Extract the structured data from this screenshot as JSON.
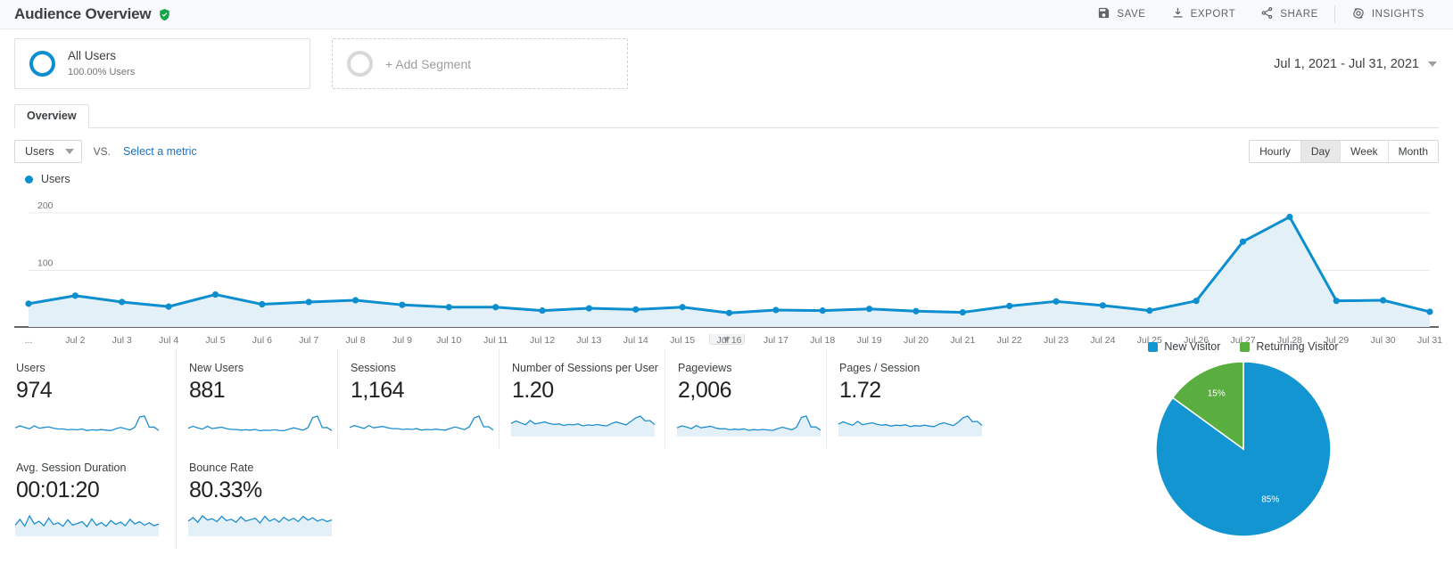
{
  "header": {
    "title": "Audience Overview",
    "verified_icon": "verified-shield-icon",
    "toolbar": [
      {
        "label": "SAVE",
        "icon": "save-floppy-icon"
      },
      {
        "label": "EXPORT",
        "icon": "export-download-icon"
      },
      {
        "label": "SHARE",
        "icon": "share-nodes-icon"
      },
      {
        "label": "INSIGHTS",
        "icon": "insights-icon"
      }
    ]
  },
  "segments": {
    "all_users": {
      "name": "All Users",
      "sub": "100.00% Users"
    },
    "add_segment": {
      "label": "+ Add Segment"
    }
  },
  "date_range": {
    "value": "Jul 1, 2021 - Jul 31, 2021"
  },
  "tabs": [
    {
      "label": "Overview",
      "active": true
    }
  ],
  "metric_selector": {
    "selected": "Users",
    "vs_label": "VS.",
    "compare_link": "Select a metric"
  },
  "granularity": {
    "options": [
      "Hourly",
      "Day",
      "Week",
      "Month"
    ],
    "selected": "Day"
  },
  "chart_data": {
    "type": "line",
    "title": "Users",
    "legend": [
      "Users"
    ],
    "legend_position": "top-left",
    "grid": true,
    "xlabel": "",
    "ylabel": "",
    "ylim": [
      0,
      220
    ],
    "yticks": [
      100,
      200
    ],
    "categories": [
      "...",
      "Jul 2",
      "Jul 3",
      "Jul 4",
      "Jul 5",
      "Jul 6",
      "Jul 7",
      "Jul 8",
      "Jul 9",
      "Jul 10",
      "Jul 11",
      "Jul 12",
      "Jul 13",
      "Jul 14",
      "Jul 15",
      "Jul 16",
      "Jul 17",
      "Jul 18",
      "Jul 19",
      "Jul 20",
      "Jul 21",
      "Jul 22",
      "Jul 23",
      "Jul 24",
      "Jul 25",
      "Jul 26",
      "Jul 27",
      "Jul 28",
      "Jul 29",
      "Jul 30",
      "Jul 31"
    ],
    "series": [
      {
        "name": "Users",
        "values": [
          42,
          56,
          45,
          37,
          58,
          41,
          45,
          48,
          40,
          36,
          36,
          30,
          34,
          32,
          36,
          26,
          31,
          30,
          33,
          29,
          27,
          38,
          46,
          39,
          30,
          47,
          150,
          193,
          47,
          48,
          28
        ]
      }
    ]
  },
  "collapse_icon": "chevron-down-icon",
  "metric_cards": [
    {
      "label": "Users",
      "value": "974"
    },
    {
      "label": "New Users",
      "value": "881"
    },
    {
      "label": "Sessions",
      "value": "1,164"
    },
    {
      "label": "Number of Sessions per User",
      "value": "1.20"
    },
    {
      "label": "Pageviews",
      "value": "2,006"
    },
    {
      "label": "Pages / Session",
      "value": "1.72"
    },
    {
      "label": "Avg. Session Duration",
      "value": "00:01:20"
    },
    {
      "label": "Bounce Rate",
      "value": "80.33%"
    }
  ],
  "pie_chart": {
    "type": "pie",
    "title": "",
    "legend_position": "top",
    "labels": [
      "New Visitor",
      "Returning Visitor"
    ],
    "values": [
      85,
      15
    ],
    "value_labels": [
      "85%",
      "15%"
    ],
    "colors": [
      "#1395d1",
      "#5aad3f"
    ]
  },
  "colors": {
    "accent_blue": "#1a73c8",
    "line_blue": "#0d8ecf",
    "area_fill": "#e3f0f7",
    "pie_green": "#5aad3f",
    "verified_green": "#16a34a"
  }
}
